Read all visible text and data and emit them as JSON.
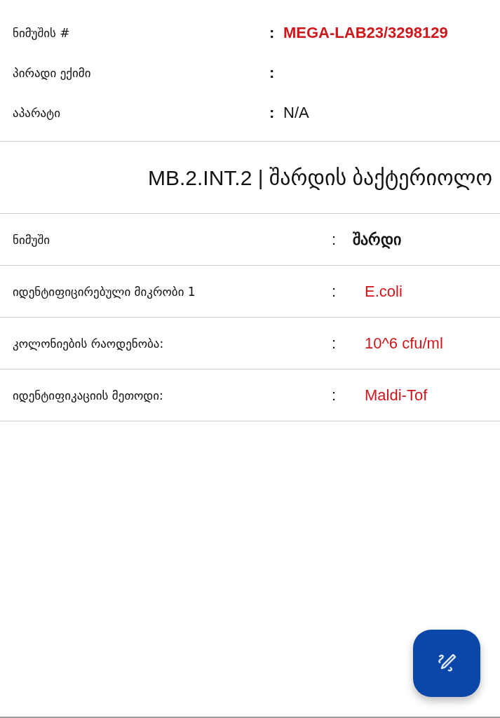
{
  "header_fields": [
    {
      "label": "ნიმუშის #",
      "separator": ":",
      "value": "MEGA-LAB23/3298129",
      "color": "#d0161b",
      "bold": true
    },
    {
      "label": "პირადი ექიმი",
      "separator": ":"
    },
    {
      "label": "აპარატი",
      "separator": ":",
      "value": "N/A",
      "color": "#111111",
      "bold": false
    }
  ],
  "test_title": "MB.2.INT.2 | შარდის ბაქტერიოლო",
  "results": [
    {
      "label": "ნიმუში",
      "separator": ":",
      "value": "შარდი",
      "color": "#111111",
      "bold": true
    },
    {
      "label": "იდენტიფიცირებული მიკრობი 1",
      "separator": ":",
      "value": "E.coli",
      "color": "#d0161b",
      "bold": false
    },
    {
      "label": "კოლონიების  რაოდენობა:",
      "separator": ":",
      "value": "10^6 cfu/ml",
      "color": "#d0161b",
      "bold": false
    },
    {
      "label": "იდენტიფიკაციის  მეთოდი:",
      "separator": ":",
      "value": "Maldi-Tof",
      "color": "#d0161b",
      "bold": false
    }
  ]
}
